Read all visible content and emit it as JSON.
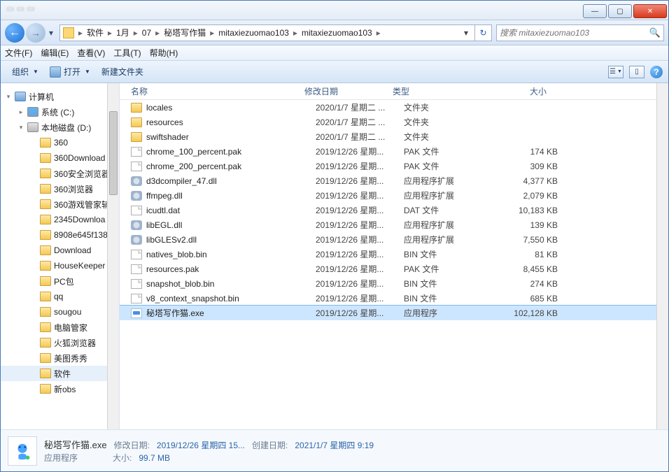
{
  "window": {
    "min": "—",
    "max": "▢",
    "close": "✕"
  },
  "breadcrumbs": [
    "软件",
    "1月",
    "07",
    "秘塔写作猫",
    "mitaxiezuomao103",
    "mitaxiezuomao103"
  ],
  "refresh_glyph": "↻",
  "search": {
    "placeholder": "搜索 mitaxiezuomao103",
    "icon": "🔍"
  },
  "menu": {
    "file": "文件(F)",
    "edit": "编辑(E)",
    "view": "查看(V)",
    "tools": "工具(T)",
    "help": "帮助(H)"
  },
  "cmd": {
    "organize": "组织",
    "open": "打开",
    "newfolder": "新建文件夹",
    "view_dd": "▾",
    "help": "?"
  },
  "tree": [
    {
      "level": 0,
      "icon": "computer",
      "label": "计算机",
      "exp": "▾"
    },
    {
      "level": 1,
      "icon": "drive",
      "label": "系统 (C:)",
      "drive_tint": "#5fb3f0",
      "exp": "▸"
    },
    {
      "level": 1,
      "icon": "drive",
      "label": "本地磁盘 (D:)",
      "exp": "▾"
    },
    {
      "level": 2,
      "icon": "folder",
      "label": "360"
    },
    {
      "level": 2,
      "icon": "folder",
      "label": "360Download"
    },
    {
      "level": 2,
      "icon": "folder",
      "label": "360安全浏览器"
    },
    {
      "level": 2,
      "icon": "folder",
      "label": "360浏览器"
    },
    {
      "level": 2,
      "icon": "folder",
      "label": "360游戏管家辅"
    },
    {
      "level": 2,
      "icon": "folder",
      "label": "2345Downloa"
    },
    {
      "level": 2,
      "icon": "folder",
      "label": "8908e645f138"
    },
    {
      "level": 2,
      "icon": "folder",
      "label": "Download"
    },
    {
      "level": 2,
      "icon": "folder",
      "label": "HouseKeeper"
    },
    {
      "level": 2,
      "icon": "folder",
      "label": "PC包"
    },
    {
      "level": 2,
      "icon": "folder",
      "label": "qq"
    },
    {
      "level": 2,
      "icon": "folder",
      "label": "sougou"
    },
    {
      "level": 2,
      "icon": "folder",
      "label": "电脑管家"
    },
    {
      "level": 2,
      "icon": "folder",
      "label": "火狐浏览器"
    },
    {
      "level": 2,
      "icon": "folder",
      "label": "美图秀秀"
    },
    {
      "level": 2,
      "icon": "folder",
      "label": "软件",
      "sel": true
    },
    {
      "level": 2,
      "icon": "folder",
      "label": "新obs"
    }
  ],
  "columns": {
    "name": "名称",
    "date": "修改日期",
    "type": "类型",
    "size": "大小"
  },
  "files": [
    {
      "icon": "folder",
      "name": "locales",
      "date": "2020/1/7 星期二 ...",
      "type": "文件夹",
      "size": ""
    },
    {
      "icon": "folder",
      "name": "resources",
      "date": "2020/1/7 星期二 ...",
      "type": "文件夹",
      "size": ""
    },
    {
      "icon": "folder",
      "name": "swiftshader",
      "date": "2020/1/7 星期二 ...",
      "type": "文件夹",
      "size": ""
    },
    {
      "icon": "file",
      "name": "chrome_100_percent.pak",
      "date": "2019/12/26 星期...",
      "type": "PAK 文件",
      "size": "174 KB"
    },
    {
      "icon": "file",
      "name": "chrome_200_percent.pak",
      "date": "2019/12/26 星期...",
      "type": "PAK 文件",
      "size": "309 KB"
    },
    {
      "icon": "gear",
      "name": "d3dcompiler_47.dll",
      "date": "2019/12/26 星期...",
      "type": "应用程序扩展",
      "size": "4,377 KB"
    },
    {
      "icon": "gear",
      "name": "ffmpeg.dll",
      "date": "2019/12/26 星期...",
      "type": "应用程序扩展",
      "size": "2,079 KB"
    },
    {
      "icon": "file",
      "name": "icudtl.dat",
      "date": "2019/12/26 星期...",
      "type": "DAT 文件",
      "size": "10,183 KB"
    },
    {
      "icon": "gear",
      "name": "libEGL.dll",
      "date": "2019/12/26 星期...",
      "type": "应用程序扩展",
      "size": "139 KB"
    },
    {
      "icon": "gear",
      "name": "libGLESv2.dll",
      "date": "2019/12/26 星期...",
      "type": "应用程序扩展",
      "size": "7,550 KB"
    },
    {
      "icon": "file",
      "name": "natives_blob.bin",
      "date": "2019/12/26 星期...",
      "type": "BIN 文件",
      "size": "81 KB"
    },
    {
      "icon": "file",
      "name": "resources.pak",
      "date": "2019/12/26 星期...",
      "type": "PAK 文件",
      "size": "8,455 KB"
    },
    {
      "icon": "file",
      "name": "snapshot_blob.bin",
      "date": "2019/12/26 星期...",
      "type": "BIN 文件",
      "size": "274 KB"
    },
    {
      "icon": "file",
      "name": "v8_context_snapshot.bin",
      "date": "2019/12/26 星期...",
      "type": "BIN 文件",
      "size": "685 KB"
    },
    {
      "icon": "app",
      "name": "秘塔写作猫.exe",
      "date": "2019/12/26 星期...",
      "type": "应用程序",
      "size": "102,128 KB",
      "sel": true
    }
  ],
  "details": {
    "name": "秘塔写作猫.exe",
    "type": "应用程序",
    "mod_label": "修改日期:",
    "mod_val": "2019/12/26 星期四 15...",
    "create_label": "创建日期:",
    "create_val": "2021/1/7 星期四 9:19",
    "size_label": "大小:",
    "size_val": "99.7 MB"
  }
}
